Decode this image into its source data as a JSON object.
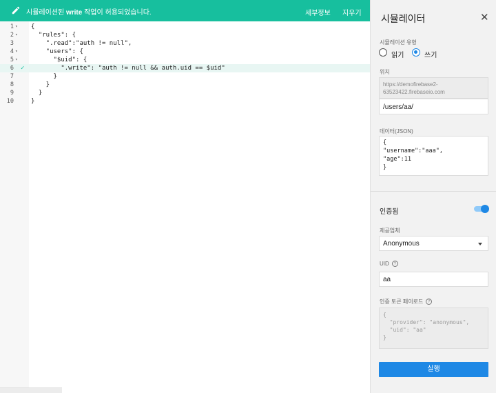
{
  "banner": {
    "message_prefix": "시뮬레이션된",
    "message_bold": "write",
    "message_suffix": "작업이 허용되었습니다.",
    "detail_label": "세부정보",
    "clear_label": "지우기"
  },
  "editor": {
    "lines": [
      {
        "num": "1",
        "fold": true,
        "check": false,
        "highlight": false,
        "text": "{"
      },
      {
        "num": "2",
        "fold": true,
        "check": false,
        "highlight": false,
        "text": "  \"rules\": {"
      },
      {
        "num": "3",
        "fold": false,
        "check": false,
        "highlight": false,
        "text": "    \".read\":\"auth != null\","
      },
      {
        "num": "4",
        "fold": true,
        "check": false,
        "highlight": false,
        "text": "    \"users\": {"
      },
      {
        "num": "5",
        "fold": true,
        "check": false,
        "highlight": false,
        "text": "      \"$uid\": {"
      },
      {
        "num": "6",
        "fold": false,
        "check": true,
        "highlight": true,
        "text": "        \".write\": \"auth != null && auth.uid == $uid\""
      },
      {
        "num": "7",
        "fold": false,
        "check": false,
        "highlight": false,
        "text": "      }"
      },
      {
        "num": "8",
        "fold": false,
        "check": false,
        "highlight": false,
        "text": "    }"
      },
      {
        "num": "9",
        "fold": false,
        "check": false,
        "highlight": false,
        "text": "  }"
      },
      {
        "num": "10",
        "fold": false,
        "check": false,
        "highlight": false,
        "text": "}"
      }
    ]
  },
  "simulator": {
    "title": "시뮬레이터",
    "type_label": "시뮬레이션 유형",
    "read_label": "읽기",
    "write_label": "쓰기",
    "selected_type": "write",
    "location_label": "위치",
    "base_url": "https://demofirebase2-63523422.firebaseio.com",
    "path_value": "/users/aa/",
    "data_label": "데이터(JSON)",
    "data_json": "{\n\"username\":\"aaa\",\n\"age\":11\n}",
    "auth_label": "인증됨",
    "auth_enabled": true,
    "provider_label": "제공업체",
    "provider_value": "Anonymous",
    "uid_label": "UID",
    "uid_value": "aa",
    "token_label": "인증 토큰 페이로드",
    "token_json": "{\n  \"provider\": \"anonymous\",\n  \"uid\": \"aa\"\n}",
    "run_label": "실행"
  },
  "colors": {
    "banner": "#17bf9e",
    "accent": "#1e88e5"
  }
}
